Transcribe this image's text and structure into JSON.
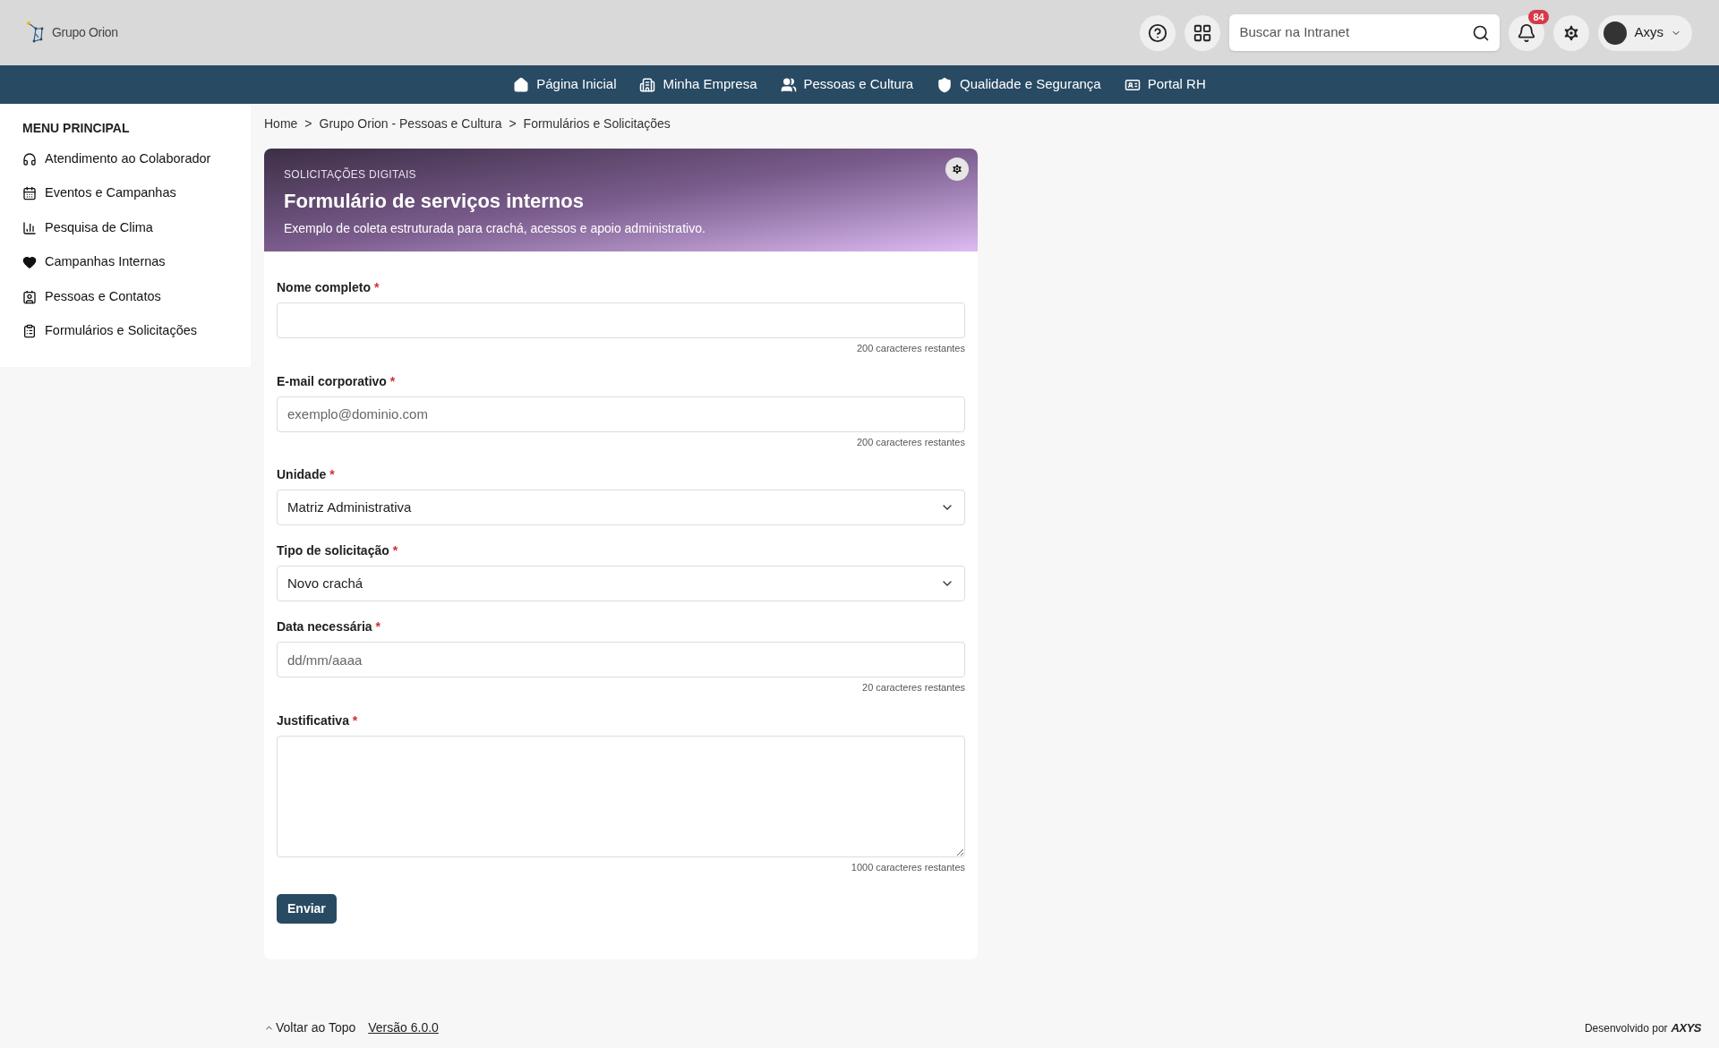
{
  "header": {
    "logo_text": "Grupo Orion",
    "search": {
      "placeholder": "Buscar na Intranet"
    },
    "notifications": {
      "count": "84"
    },
    "user": {
      "name": "Axys"
    }
  },
  "nav": [
    {
      "label": "Página Inicial"
    },
    {
      "label": "Minha Empresa"
    },
    {
      "label": "Pessoas e Cultura"
    },
    {
      "label": "Qualidade e Segurança"
    },
    {
      "label": "Portal RH"
    }
  ],
  "sidebar": {
    "title": "MENU PRINCIPAL",
    "items": [
      {
        "label": "Atendimento ao Colaborador"
      },
      {
        "label": "Eventos e Campanhas"
      },
      {
        "label": "Pesquisa de Clima"
      },
      {
        "label": "Campanhas Internas"
      },
      {
        "label": "Pessoas e Contatos"
      },
      {
        "label": "Formulários e Solicitações"
      }
    ]
  },
  "breadcrumb": [
    {
      "label": "Home"
    },
    {
      "label": "Grupo Orion - Pessoas e Cultura"
    },
    {
      "label": "Formulários e Solicitações"
    }
  ],
  "breadcrumb_separator": ">",
  "banner": {
    "eyebrow": "SOLICITAÇÕES DIGITAIS",
    "title": "Formulário de serviços internos",
    "subtitle": "Exemplo de coleta estruturada para crachá, acessos e apoio administrativo."
  },
  "form": {
    "required_mark": "*",
    "fields": [
      {
        "kind": "text",
        "label": "Nome completo",
        "counter": "200 caracteres restantes"
      },
      {
        "kind": "text",
        "label": "E-mail corporativo",
        "placeholder": "exemplo@dominio.com",
        "counter": "200 caracteres restantes"
      },
      {
        "kind": "select",
        "label": "Unidade",
        "value": "Matriz Administrativa"
      },
      {
        "kind": "select",
        "label": "Tipo de solicitação",
        "value": "Novo crachá"
      },
      {
        "kind": "text",
        "label": "Data necessária",
        "placeholder": "dd/mm/aaaa",
        "counter": "20 caracteres restantes"
      },
      {
        "kind": "textarea",
        "label": "Justificativa",
        "counter": "1000 caracteres restantes"
      }
    ],
    "submit": "Enviar"
  },
  "footer": {
    "back_to_top": "Voltar ao Topo",
    "version": "Versão 6.0.0",
    "credit": "Desenvolvido por",
    "brand": "AXYS"
  }
}
